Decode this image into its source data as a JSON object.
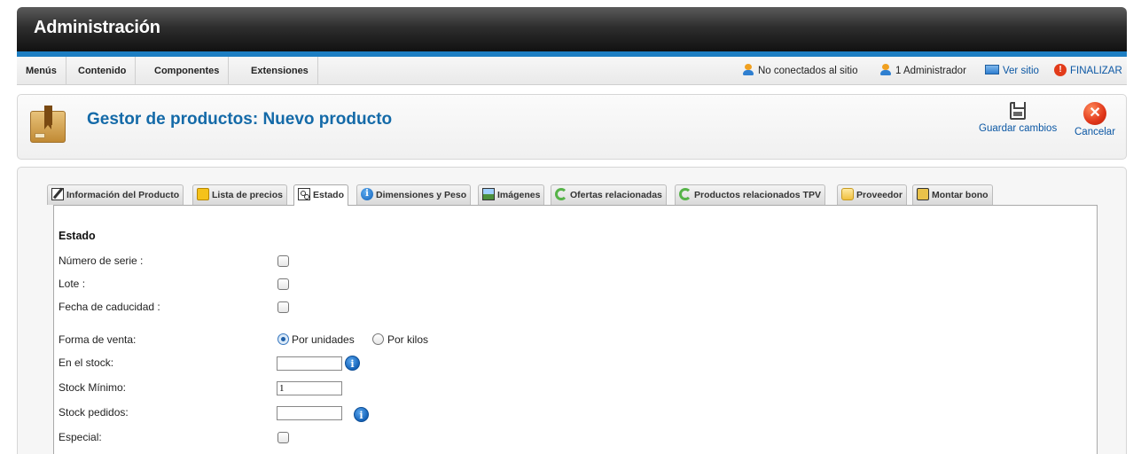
{
  "header": {
    "title": "Administración"
  },
  "menubar": {
    "items": [
      {
        "label": "Menús"
      },
      {
        "label": "Contenido"
      },
      {
        "label": "Componentes"
      },
      {
        "label": "Extensiones"
      }
    ],
    "status": {
      "not_connected": "No conectados al sitio",
      "admins": "1 Administrador",
      "view_site": "Ver sitio",
      "logout": "FINALIZAR"
    }
  },
  "toolbar": {
    "title": "Gestor de productos: Nuevo producto",
    "save_label": "Guardar cambios",
    "cancel_label": "Cancelar"
  },
  "tabs": [
    {
      "label": "Información del Producto",
      "icon": "edit-icon",
      "active": false
    },
    {
      "label": "Lista de precios",
      "icon": "price-list-icon",
      "active": false
    },
    {
      "label": "Estado",
      "icon": "state-icon",
      "active": true
    },
    {
      "label": "Dimensiones y Peso",
      "icon": "info-icon",
      "active": false
    },
    {
      "label": "Imágenes",
      "icon": "image-icon",
      "active": false
    },
    {
      "label": "Ofertas relacionadas",
      "icon": "sync-icon",
      "active": false
    },
    {
      "label": "Productos relacionados TPV",
      "icon": "sync-icon",
      "active": false
    },
    {
      "label": "Proveedor",
      "icon": "supplier-icon",
      "active": false
    },
    {
      "label": "Montar bono",
      "icon": "bono-icon",
      "active": false
    }
  ],
  "form": {
    "section_title": "Estado",
    "serial_label": "Número de serie :",
    "lot_label": "Lote :",
    "expiry_label": "Fecha de caducidad :",
    "sale_form_label": "Forma de venta:",
    "sale_by_units": "Por unidades",
    "sale_by_kilos": "Por kilos",
    "sale_form_selected": "Por unidades",
    "in_stock_label": "En el stock:",
    "in_stock_value": "",
    "min_stock_label": "Stock Mínimo:",
    "min_stock_value": "1",
    "ordered_stock_label": "Stock pedidos:",
    "ordered_stock_value": "",
    "special_label": "Especial:"
  }
}
